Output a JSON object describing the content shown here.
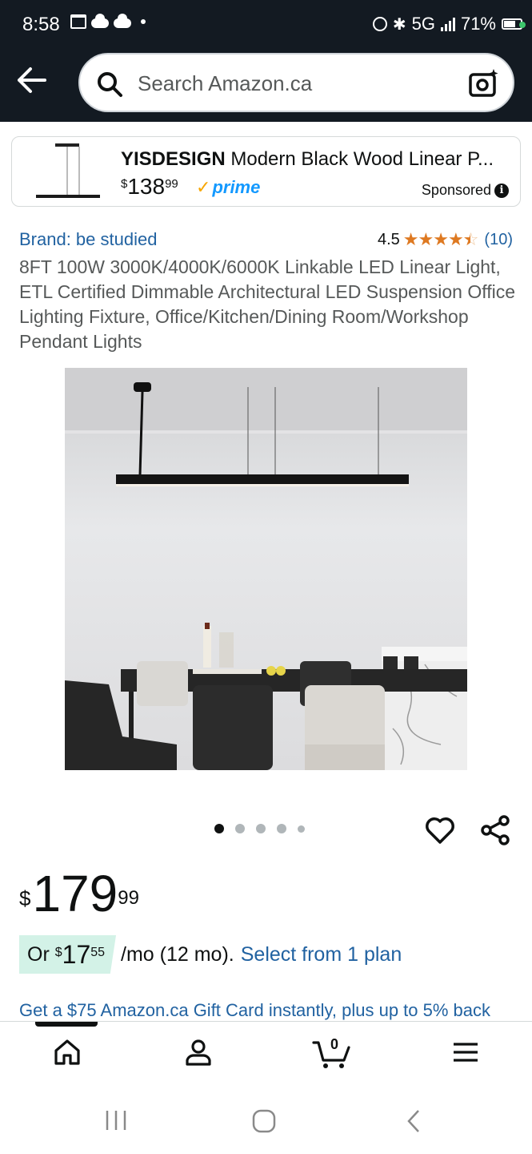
{
  "status_bar": {
    "time": "8:58",
    "network": "5G",
    "battery": "71%"
  },
  "header": {
    "search_placeholder": "Search Amazon.ca"
  },
  "sponsored": {
    "brand": "YISDESIGN",
    "title_rest": " Modern Black Wood Linear P...",
    "price_symbol": "$",
    "price_whole": "138",
    "price_cents": "99",
    "prime_label": "prime",
    "label": "Sponsored"
  },
  "product": {
    "brand": "Brand: be studied",
    "rating_value": "4.5",
    "rating_stars": 4.5,
    "rating_count": "(10)",
    "title": "8FT 100W 3000K/4000K/6000K Linkable LED Linear Light, ETL Certified Dimmable Architectural LED Suspension Office Lighting Fixture, Office/Kitchen/Dining Room/Workshop Pendant Lights",
    "image_count": 5,
    "active_image_index": 0,
    "price_symbol": "$",
    "price_whole": "179",
    "price_cents": "99",
    "monthly_prefix": "Or ",
    "monthly_symbol": "$",
    "monthly_whole": "17",
    "monthly_cents": "55",
    "monthly_suffix": "/mo (12 mo).",
    "monthly_link": "Select from 1 plan",
    "gift_card_text": "Get a $75 Amazon.ca Gift Card instantly, plus up to 5% back"
  },
  "bottom_nav": {
    "cart_count": "0",
    "items": [
      "home-icon",
      "account-icon",
      "cart-icon",
      "menu-icon"
    ]
  },
  "colors": {
    "header_bg": "#131a22",
    "link": "#2162a1",
    "star": "#de7921",
    "prime": "#1399ff",
    "monthly_badge": "#d3f2e7"
  }
}
